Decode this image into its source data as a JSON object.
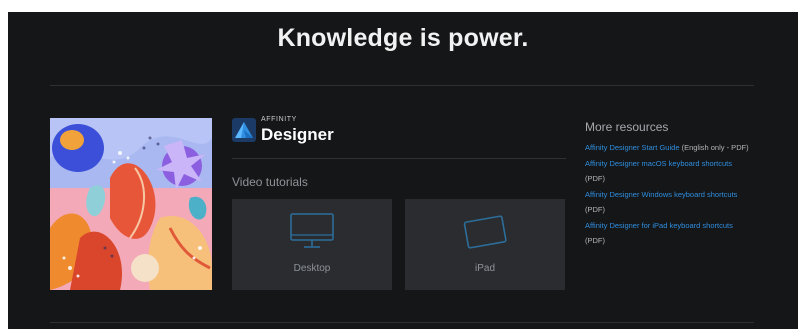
{
  "headline": "Knowledge is power.",
  "brand": {
    "small_text": "AFFINITY",
    "product_name": "Designer",
    "logo_icon": "affinity-designer-logo"
  },
  "video_section": {
    "title": "Video tutorials",
    "cards": [
      {
        "label": "Desktop",
        "icon": "desktop-monitor-icon"
      },
      {
        "label": "iPad",
        "icon": "ipad-tablet-icon"
      }
    ]
  },
  "resources": {
    "title": "More resources",
    "links": [
      {
        "link_text": "Affinity Designer Start Guide",
        "suffix": " (English only - PDF)"
      },
      {
        "link_text": "Affinity Designer macOS keyboard shortcuts",
        "suffix": " (PDF)"
      },
      {
        "link_text": "Affinity Designer Windows keyboard shortcuts",
        "suffix": " (PDF)"
      },
      {
        "link_text": "Affinity Designer for iPad keyboard shortcuts",
        "suffix": " (PDF)"
      }
    ]
  },
  "colors": {
    "background": "#151617",
    "card": "#2a2c30",
    "link": "#2f8ee0",
    "icon_stroke": "#2c6e99"
  }
}
